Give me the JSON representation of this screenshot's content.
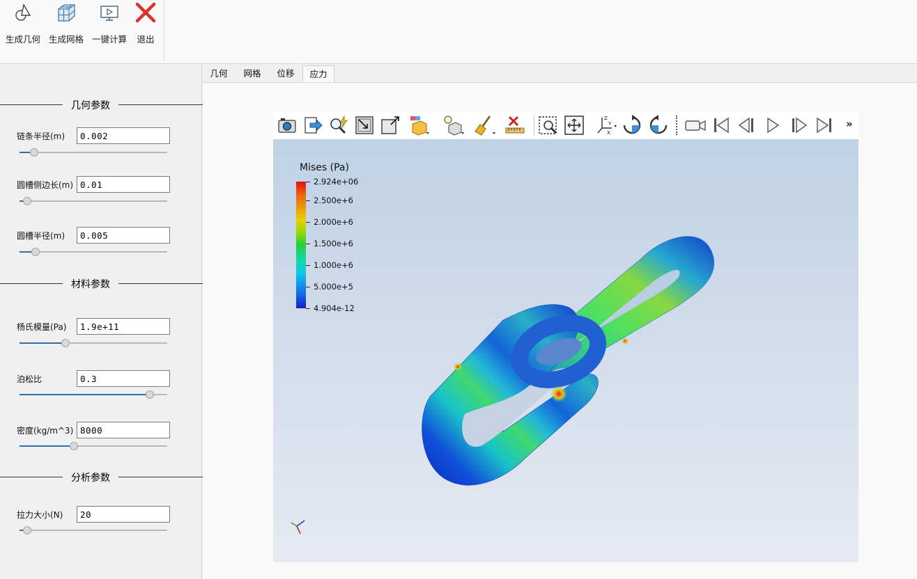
{
  "ribbon": {
    "buttons": [
      {
        "label": "生成几何",
        "icon": "geometry-icon"
      },
      {
        "label": "生成网格",
        "icon": "mesh-icon"
      },
      {
        "label": "一键计算",
        "icon": "compute-icon"
      },
      {
        "label": "退出",
        "icon": "close-icon"
      }
    ]
  },
  "left_panel": {
    "sections": [
      {
        "title": "几何参数"
      },
      {
        "title": "材料参数"
      },
      {
        "title": "分析参数"
      }
    ],
    "fields": [
      {
        "label": "链条半径(m)",
        "value": "0.002",
        "slider": 0.1
      },
      {
        "label": "圆槽侧边长(m)",
        "value": "0.01",
        "slider": 0.05
      },
      {
        "label": "圆槽半径(m)",
        "value": "0.005",
        "slider": 0.11
      },
      {
        "label": "杨氏模量(Pa)",
        "value": "1.9e+11",
        "slider": 0.31
      },
      {
        "label": "泊松比",
        "value": "0.3",
        "slider": 0.88
      },
      {
        "label": "密度(kg/m^3)",
        "value": "8000",
        "slider": 0.37
      },
      {
        "label": "拉力大小(N)",
        "value": "20",
        "slider": 0.05
      }
    ]
  },
  "tabs": [
    {
      "label": "几何",
      "active": false
    },
    {
      "label": "网格",
      "active": false
    },
    {
      "label": "位移",
      "active": false
    },
    {
      "label": "应力",
      "active": true
    }
  ],
  "view_toolbar": {
    "icons": [
      "camera-icon",
      "export-icon",
      "query-icon",
      "reset-camera-icon",
      "zoom-to-data-icon",
      "color-map-icon",
      "light-icon",
      "clear-icon",
      "ruler-icon",
      "zoom-box-icon",
      "move-icon",
      "axes-orientation-icon",
      "rotate-cw-icon",
      "rotate-ccw-icon",
      "record-icon",
      "first-frame-icon",
      "prev-frame-icon",
      "play-icon",
      "next-frame-icon",
      "last-frame-icon",
      "more-icon"
    ],
    "more_label": "»"
  },
  "legend": {
    "title": "Mises (Pa)",
    "ticks": [
      "2.924e+06",
      "2.500e+6",
      "2.000e+6",
      "1.500e+6",
      "1.000e+6",
      "5.000e+5",
      "4.904e-12"
    ]
  },
  "colors": {
    "accent": "#2a6db5",
    "exit_red": "#d9342b"
  }
}
